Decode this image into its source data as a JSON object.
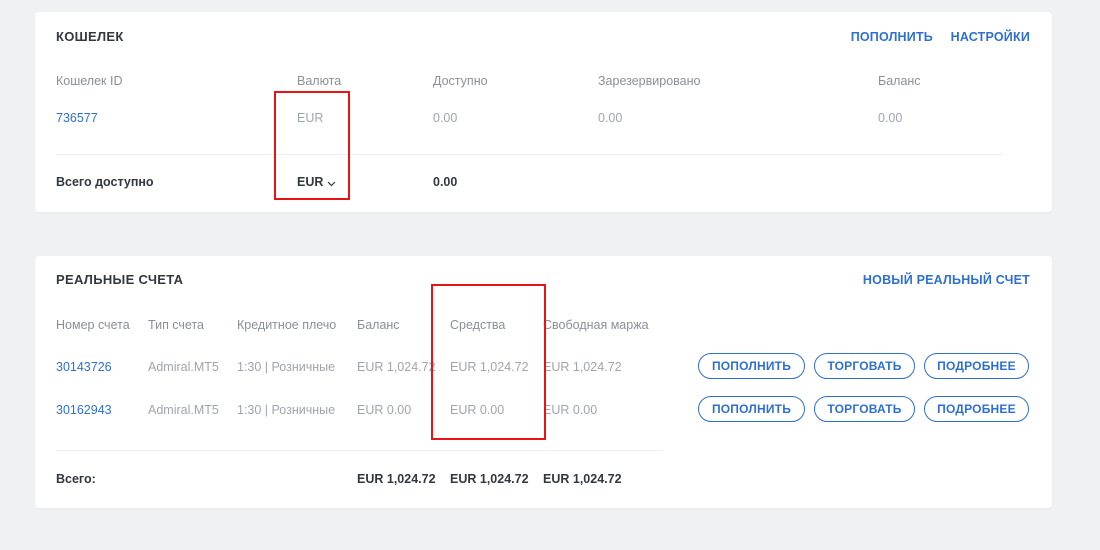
{
  "wallet": {
    "title": "КОШЕЛЕК",
    "actions": {
      "deposit": "ПОПОЛНИТЬ",
      "settings": "НАСТРОЙКИ"
    },
    "headers": {
      "id": "Кошелек ID",
      "currency": "Валюта",
      "available": "Доступно",
      "reserved": "Зарезервировано",
      "balance": "Баланс"
    },
    "row": {
      "id": "736577",
      "currency": "EUR",
      "available": "0.00",
      "reserved": "0.00",
      "balance": "0.00"
    },
    "total": {
      "label": "Всего доступно",
      "currency": "EUR",
      "value": "0.00"
    }
  },
  "accounts": {
    "title": "РЕАЛЬНЫЕ СЧЕТА",
    "new_account": "НОВЫЙ РЕАЛЬНЫЙ СЧЕТ",
    "headers": {
      "number": "Номер счета",
      "type": "Тип счета",
      "leverage": "Кредитное плечо",
      "balance": "Баланс",
      "funds": "Средства",
      "free_margin": "Свободная маржа"
    },
    "rows": [
      {
        "number": "30143726",
        "type": "Admiral.MT5",
        "leverage": "1:30 | Розничные",
        "balance": "EUR 1,024.72",
        "funds": "EUR 1,024.72",
        "free_margin": "EUR 1,024.72"
      },
      {
        "number": "30162943",
        "type": "Admiral.MT5",
        "leverage": "1:30 | Розничные",
        "balance": "EUR 0.00",
        "funds": "EUR 0.00",
        "free_margin": "EUR 0.00"
      }
    ],
    "buttons": {
      "deposit": "ПОПОЛНИТЬ",
      "trade": "ТОРГОВАТЬ",
      "details": "ПОДРОБНЕЕ"
    },
    "total": {
      "label": "Всего:",
      "balance": "EUR 1,024.72",
      "funds": "EUR 1,024.72",
      "free_margin": "EUR 1,024.72"
    }
  },
  "colors": {
    "accent": "#2f6fd1",
    "highlight": "#e81414"
  },
  "icons": {
    "currency_dropdown": "chevron-down-icon"
  }
}
